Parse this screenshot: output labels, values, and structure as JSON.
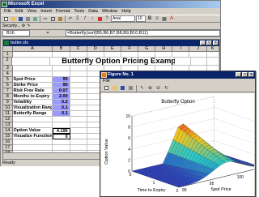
{
  "excel": {
    "title": "Microsoft Excel",
    "menu": [
      "File",
      "Edit",
      "View",
      "Insert",
      "Format",
      "Tools",
      "Data",
      "Window",
      "Help"
    ],
    "font_name": "Arial",
    "font_size": "10",
    "toolbar2_label": "Security...",
    "name_box": "B16",
    "fx": "=",
    "formula": "=Butterfly(surf(B5,B6,B7,B8,B9,B10,B11)",
    "status": "Ready"
  },
  "workbook": {
    "title": "butter.xls",
    "columns": [
      "A",
      "B",
      "C",
      "D",
      "E",
      "F",
      "G",
      "H",
      "I",
      "J",
      "K"
    ],
    "sheet_title": "Butterfly Option Pricing Example",
    "rows": [
      {
        "n": "1",
        "label": "",
        "value": ""
      },
      {
        "n": "2",
        "label": "",
        "value": ""
      },
      {
        "n": "3",
        "label": "",
        "value": ""
      },
      {
        "n": "4",
        "label": "",
        "value": ""
      },
      {
        "n": "5",
        "label": "Spot Price",
        "value": "90"
      },
      {
        "n": "6",
        "label": "Strike Price",
        "value": "90"
      },
      {
        "n": "7",
        "label": "Risk Free Rate",
        "value": "0.07"
      },
      {
        "n": "8",
        "label": "Months to Expiry",
        "value": "2.00"
      },
      {
        "n": "9",
        "label": "Volatility",
        "value": "0.2"
      },
      {
        "n": "10",
        "label": "Visualization Range",
        "value": "0.1"
      },
      {
        "n": "11",
        "label": "Butterfly Range",
        "value": "0.1"
      },
      {
        "n": "12",
        "label": "",
        "value": ""
      },
      {
        "n": "13",
        "label": "",
        "value": ""
      },
      {
        "n": "14",
        "label": "Option Value",
        "value": "4.196"
      },
      {
        "n": "15",
        "label": "Visualize Function",
        "value": "0"
      },
      {
        "n": "16",
        "label": "",
        "value": ""
      },
      {
        "n": "17",
        "label": "",
        "value": ""
      },
      {
        "n": "18",
        "label": "",
        "value": ""
      }
    ]
  },
  "figure": {
    "title": "Figure No. 1",
    "menu": "File",
    "plot_title": "Butterfly Option",
    "zlabel": "Option Value",
    "xlabel": "Time to Expiry",
    "ylabel": "Spot Price",
    "z_ticks": [
      "10",
      "8",
      "6",
      "4",
      "2",
      "0"
    ],
    "t_ticks": [
      "0",
      "1",
      "2"
    ],
    "s_ticks": [
      "90",
      "95",
      "100",
      "105"
    ]
  },
  "colors": {
    "titlebar": "#0a246a",
    "input_fill": "#9999ff",
    "chrome": "#d4d0c8"
  }
}
